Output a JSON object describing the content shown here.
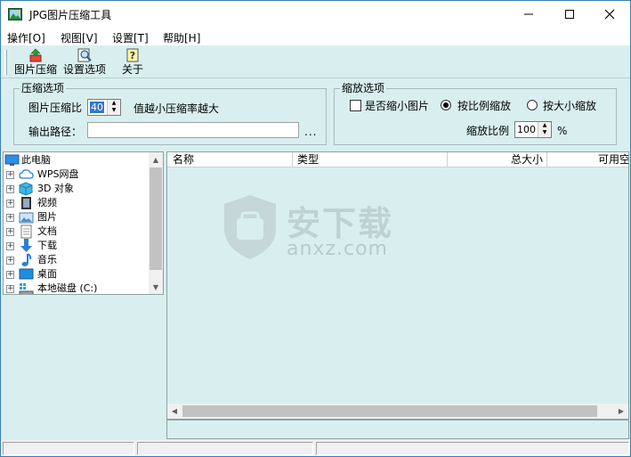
{
  "window": {
    "title": "JPG图片压缩工具"
  },
  "menu": [
    "操作[O]",
    "视图[V]",
    "设置[T]",
    "帮助[H]"
  ],
  "toolbar": {
    "compress_label": "图片压缩",
    "settings_label": "设置选项",
    "about_label": "关于"
  },
  "compress_group": {
    "title": "压缩选项",
    "ratio_label": "图片压缩比",
    "ratio_value": "40",
    "ratio_hint": "值越小压缩率越大",
    "output_label": "输出路径：",
    "output_value": "",
    "browse_label": "..."
  },
  "scale_group": {
    "title": "缩放选项",
    "shrink_label": "是否缩小图片",
    "shrink_checked": false,
    "by_ratio_label": "按比例缩放",
    "by_size_label": "按大小缩放",
    "selected": "by_ratio",
    "scale_label": "缩放比例",
    "scale_value": "100",
    "scale_unit": "%"
  },
  "tree": {
    "root": "此电脑",
    "items": [
      {
        "label": "WPS网盘",
        "icon": "cloud-icon"
      },
      {
        "label": "3D 对象",
        "icon": "cube-3d-icon"
      },
      {
        "label": "视频",
        "icon": "film-icon"
      },
      {
        "label": "图片",
        "icon": "picture-icon"
      },
      {
        "label": "文档",
        "icon": "document-icon"
      },
      {
        "label": "下载",
        "icon": "download-arrow-icon"
      },
      {
        "label": "音乐",
        "icon": "music-note-icon"
      },
      {
        "label": "桌面",
        "icon": "desktop-icon"
      },
      {
        "label": "本地磁盘 (C:)",
        "icon": "drive-icon"
      }
    ]
  },
  "list": {
    "columns": [
      "名称",
      "类型",
      "总大小",
      "可用空"
    ]
  },
  "watermark": {
    "cn": "安下载",
    "en": "anxz.com"
  },
  "colors": {
    "panel_bg": "#d9efef",
    "accent": "#3377cc"
  }
}
